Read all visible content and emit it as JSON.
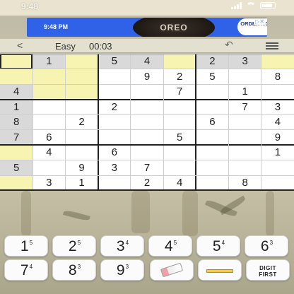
{
  "status_bar": {
    "time": "9:48"
  },
  "ad": {
    "time": "9:48 PM",
    "brand": "OREO",
    "cta": "ORDER NOW"
  },
  "toolbar": {
    "back": "<",
    "difficulty": "Easy",
    "timer": "00:03",
    "undo": "↶"
  },
  "board": {
    "rows": [
      [
        "",
        "1",
        "",
        "5",
        "4",
        "",
        "2",
        "3",
        ""
      ],
      [
        "",
        "",
        "",
        "",
        "9",
        "2",
        "5",
        "",
        "8"
      ],
      [
        "4",
        "",
        "",
        "",
        "",
        "7",
        "",
        "1",
        ""
      ],
      [
        "1",
        "",
        "",
        "2",
        "",
        "",
        "",
        "7",
        "3"
      ],
      [
        "8",
        "",
        "2",
        "",
        "",
        "",
        "6",
        "",
        "4"
      ],
      [
        "7",
        "6",
        "",
        "",
        "",
        "5",
        "",
        "",
        "9"
      ],
      [
        "",
        "4",
        "",
        "6",
        "",
        "",
        "",
        "",
        "1"
      ],
      [
        "5",
        "",
        "9",
        "3",
        "7",
        "",
        "",
        "",
        ""
      ],
      [
        "",
        "3",
        "1",
        "",
        "2",
        "4",
        "",
        "8",
        ""
      ]
    ],
    "highlight": [
      [
        "y",
        "g",
        "y",
        "g",
        "g",
        "y",
        "g",
        "g",
        "y"
      ],
      [
        "y",
        "y",
        "y",
        "",
        "",
        "",
        "",
        "",
        ""
      ],
      [
        "g",
        "y",
        "y",
        "",
        "",
        "",
        "",
        "",
        ""
      ],
      [
        "g",
        "",
        "",
        "",
        "",
        "",
        "",
        "",
        ""
      ],
      [
        "g",
        "",
        "",
        "",
        "",
        "",
        "",
        "",
        ""
      ],
      [
        "g",
        "",
        "",
        "",
        "",
        "",
        "",
        "",
        ""
      ],
      [
        "y",
        "",
        "",
        "",
        "",
        "",
        "",
        "",
        ""
      ],
      [
        "g",
        "",
        "",
        "",
        "",
        "",
        "",
        "",
        ""
      ],
      [
        "y",
        "",
        "",
        "",
        "",
        "",
        "",
        "",
        ""
      ]
    ],
    "selected": [
      0,
      0
    ]
  },
  "keypad": {
    "keys": [
      {
        "digit": "1",
        "count": "5"
      },
      {
        "digit": "2",
        "count": "5"
      },
      {
        "digit": "3",
        "count": "4"
      },
      {
        "digit": "4",
        "count": "5"
      },
      {
        "digit": "5",
        "count": "4"
      },
      {
        "digit": "6",
        "count": "3"
      },
      {
        "digit": "7",
        "count": "4"
      },
      {
        "digit": "8",
        "count": "3"
      },
      {
        "digit": "9",
        "count": "3"
      }
    ],
    "digit_first_line1": "DIGIT",
    "digit_first_line2": "FIRST"
  },
  "colors": {
    "yellow": "#f7f3b0",
    "gray": "#d9d9d9"
  }
}
